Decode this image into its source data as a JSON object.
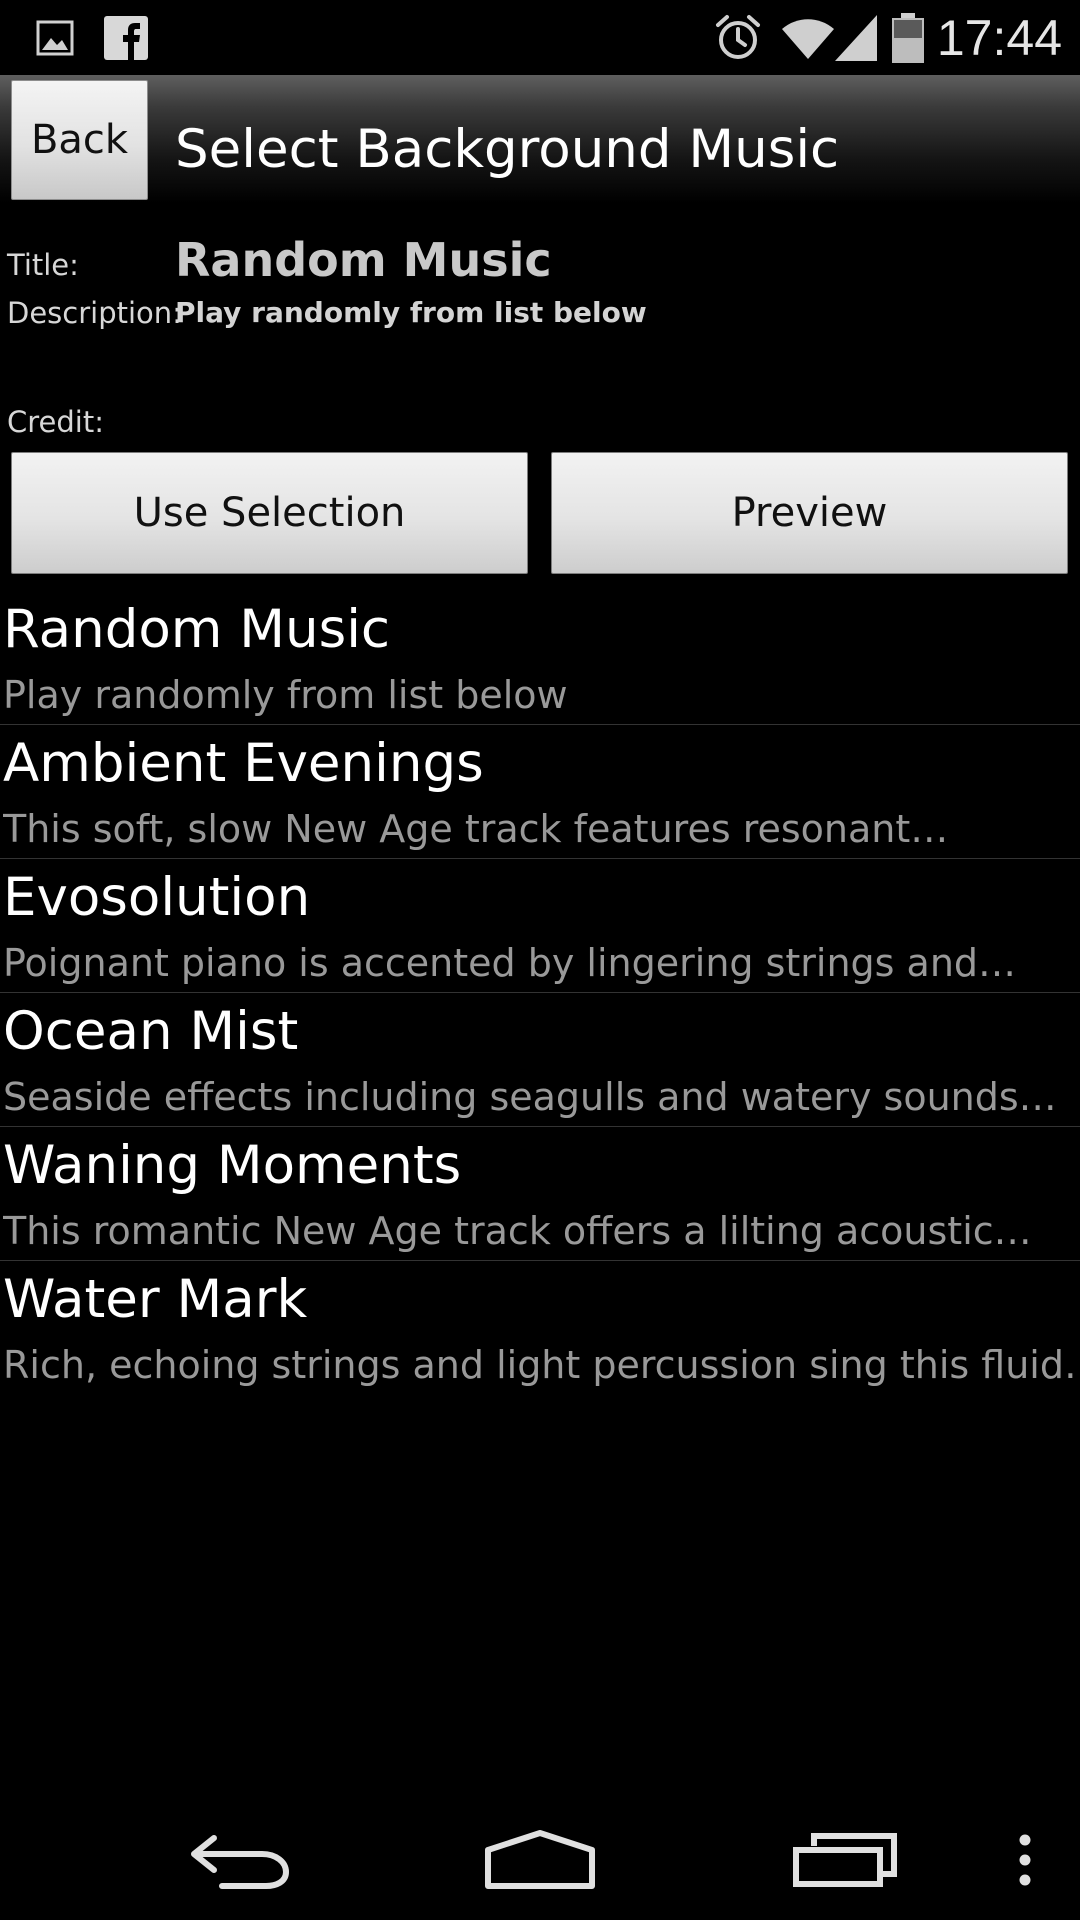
{
  "status_bar": {
    "time": "17:44",
    "left_icons": [
      "image-icon",
      "facebook-icon"
    ],
    "right_icons": [
      "alarm-icon",
      "wifi-icon",
      "signal-icon",
      "battery-icon"
    ]
  },
  "header": {
    "back_label": "Back",
    "title": "Select Background Music"
  },
  "info": {
    "title_label": "Title:",
    "title_value": "Random Music",
    "description_label": "Description:",
    "description_value": "Play randomly from list below",
    "credit_label": "Credit:"
  },
  "actions": {
    "use_selection_label": "Use Selection",
    "preview_label": "Preview"
  },
  "music_list": [
    {
      "name": "Random Music",
      "description": "Play randomly from list below"
    },
    {
      "name": "Ambient Evenings",
      "description": "This soft, slow New Age track features resonant…"
    },
    {
      "name": "Evosolution",
      "description": "Poignant piano is accented by lingering strings and…"
    },
    {
      "name": "Ocean Mist",
      "description": "Seaside effects including seagulls and watery sounds…"
    },
    {
      "name": "Waning Moments",
      "description": "This romantic New Age track offers a lilting acoustic…"
    },
    {
      "name": "Water Mark",
      "description": "Rich, echoing strings and light percussion sing this fluid…"
    }
  ],
  "nav_bar": {
    "icons": [
      "back-nav-icon",
      "home-nav-icon",
      "recents-nav-icon",
      "overflow-menu-icon"
    ]
  },
  "colors": {
    "background": "#000000",
    "button_face": "#e4e4e4",
    "secondary_text": "#999999"
  }
}
